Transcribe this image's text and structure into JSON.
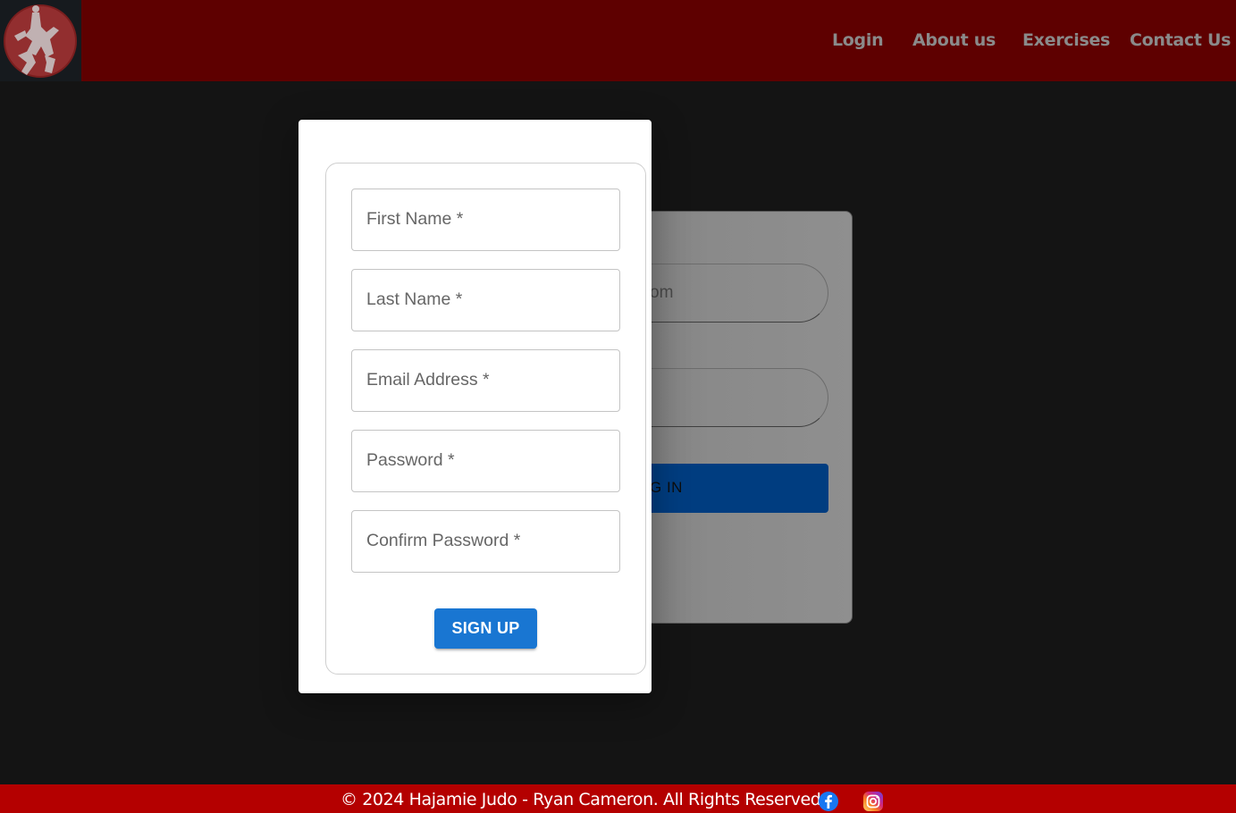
{
  "header": {
    "logo_alt": "Hajamie Judo logo",
    "nav": {
      "login": "Login",
      "about": "About us",
      "exercises": "Exercises",
      "contact": "Contact Us"
    }
  },
  "login_card": {
    "email_partial_text": "om",
    "button_partial_text": "G IN"
  },
  "signup_modal": {
    "fields": {
      "first_name": "First Name *",
      "last_name": "Last Name *",
      "email": "Email Address *",
      "password": "Password *",
      "confirm_password": "Confirm Password *"
    },
    "signup_label": "SIGN UP"
  },
  "footer": {
    "copyright": "© 2024 Hajamie Judo - Ryan Cameron. All Rights Reserved.",
    "social": [
      "facebook-icon",
      "instagram-icon"
    ]
  },
  "colors": {
    "header_bg": "#5e0000",
    "footer_bg": "#b40000",
    "page_bg": "#141414",
    "primary_button": "#1976d2",
    "login_button": "#003d80"
  }
}
